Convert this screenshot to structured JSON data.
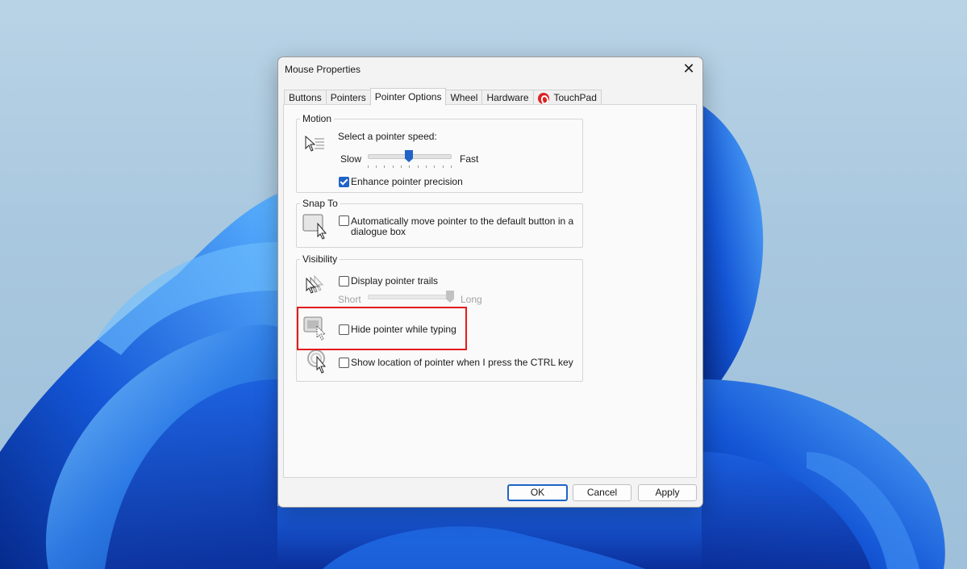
{
  "window": {
    "title": "Mouse Properties",
    "close_symbol": "✕"
  },
  "tabs": [
    {
      "label": "Buttons"
    },
    {
      "label": "Pointers"
    },
    {
      "label": "Pointer Options",
      "active": true
    },
    {
      "label": "Wheel"
    },
    {
      "label": "Hardware"
    },
    {
      "label": "TouchPad",
      "icon": "touchpad-logo-icon"
    }
  ],
  "motion": {
    "group_title": "Motion",
    "speed_label": "Select a pointer speed:",
    "slow_label": "Slow",
    "fast_label": "Fast",
    "speed_value": 0.5,
    "precision_label": "Enhance pointer precision",
    "precision_checked": true
  },
  "snap_to": {
    "group_title": "Snap To",
    "auto_label_line1": "Automatically move pointer to the default button in a",
    "auto_label_line2": "dialogue box",
    "auto_checked": false
  },
  "visibility": {
    "group_title": "Visibility",
    "trails_label": "Display pointer trails",
    "trails_checked": false,
    "short_label": "Short",
    "long_label": "Long",
    "trail_value": 1.0,
    "hide_label": "Hide pointer while typing",
    "hide_checked": false,
    "ctrl_label": "Show location of pointer when I press the CTRL key",
    "ctrl_checked": false
  },
  "buttons": {
    "ok": "OK",
    "cancel": "Cancel",
    "apply": "Apply"
  },
  "colors": {
    "accent": "#1f64c6",
    "highlight": "#e31b1b"
  }
}
